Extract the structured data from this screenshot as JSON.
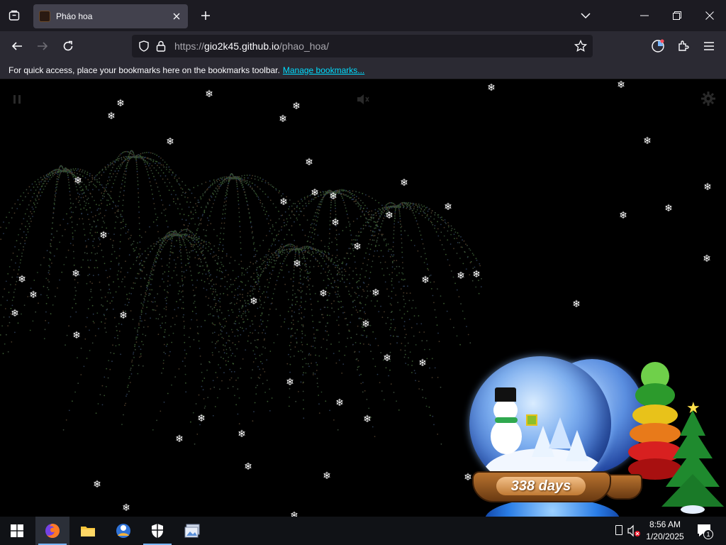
{
  "browser": {
    "tab": {
      "title": "Pháo hoa"
    },
    "url": {
      "scheme": "https://",
      "host": "gio2k45.github.io",
      "path": "/phao_hoa/"
    },
    "bookmarks_bar": {
      "message": "For quick access, place your bookmarks here on the bookmarks toolbar.",
      "link": "Manage bookmarks..."
    },
    "icons": [
      "tab-list-icon",
      "close-icon",
      "plus-icon",
      "chevron-down-icon",
      "minimize-icon",
      "maximize-icon",
      "back-icon",
      "forward-icon",
      "reload-icon",
      "shield-icon",
      "lock-icon",
      "star-icon",
      "account-icon",
      "extensions-icon",
      "menu-icon"
    ]
  },
  "page": {
    "countdown_label": "338 days",
    "controls": [
      "pause-icon",
      "mute-icon",
      "settings-icon"
    ],
    "colors": {
      "background": "#000000",
      "snow": "#ffffff",
      "globe_blue": "#3567c8",
      "base_brown": "#8a4d1c"
    }
  },
  "taskbar": {
    "apps": [
      "windows-start-icon",
      "firefox-icon",
      "file-explorer-icon",
      "app-icon",
      "security-icon",
      "photos-icon"
    ],
    "clock": {
      "time": "8:56 AM",
      "date": "1/20/2025"
    },
    "notifications_count": "1"
  }
}
